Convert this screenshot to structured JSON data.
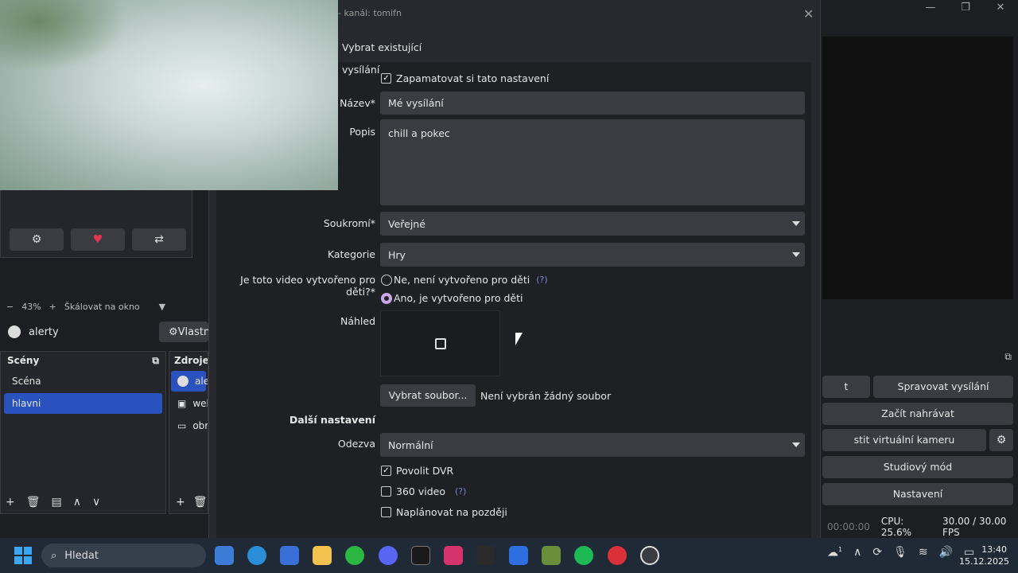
{
  "dialog": {
    "title": "- kanál: tomifn",
    "close_glyph": "✕",
    "tab_existing": "Vybrat existující vysílání",
    "remember_label": "Zapamatovat si tato nastavení",
    "name_label": "Název*",
    "name_value": "Mé vysílání",
    "description_label": "Popis",
    "description_value": "chill a pokec",
    "privacy_label": "Soukromí*",
    "privacy_value": "Veřejné",
    "category_label": "Kategorie",
    "category_value": "Hry",
    "made_for_kids_label": "Je toto video vytvořeno pro děti?*",
    "kids_option_no": "Ne, není vytvořeno pro děti",
    "kids_option_yes": "Ano, je vytvořeno pro děti",
    "help_mark": "(?)",
    "thumbnail_label": "Náhled",
    "select_file_button": "Vybrat soubor...",
    "no_file_text": "Není vybrán žádný soubor",
    "more_settings_heading": "Další nastavení",
    "latency_label": "Odezva",
    "latency_value": "Normální",
    "dvr_label": "Povolit DVR",
    "video360_label": "360 video",
    "schedule_label": "Naplánovat na později"
  },
  "obs": {
    "window_controls": [
      "—",
      "❐",
      "✕"
    ],
    "zoom_percent": "43%",
    "zoom_mode": "Škálovat na okno",
    "current_scene_label": "alerty",
    "properties_button": "Vlastn",
    "scenes_header": "Scény",
    "scenes": [
      "Scéna",
      "hlavni"
    ],
    "sources_header": "Zdroje",
    "sources": [
      "aler",
      "web",
      "obr"
    ],
    "controls": {
      "stream_button_partial": "t",
      "manage_broadcast": "Spravovat vysílání",
      "start_recording": "Začít nahrávat",
      "virtual_camera": "stit virtuální kameru",
      "studio_mode": "Studiový mód",
      "settings": "Nastavení"
    },
    "status": {
      "time": "00:00:00",
      "cpu": "CPU: 25.6%",
      "fps": "30.00 / 30.00 FPS"
    }
  },
  "taskbar": {
    "search_placeholder": "Hledat",
    "clock_time": "13:40",
    "clock_date": "15.12.2025",
    "weather_badge": "1"
  }
}
